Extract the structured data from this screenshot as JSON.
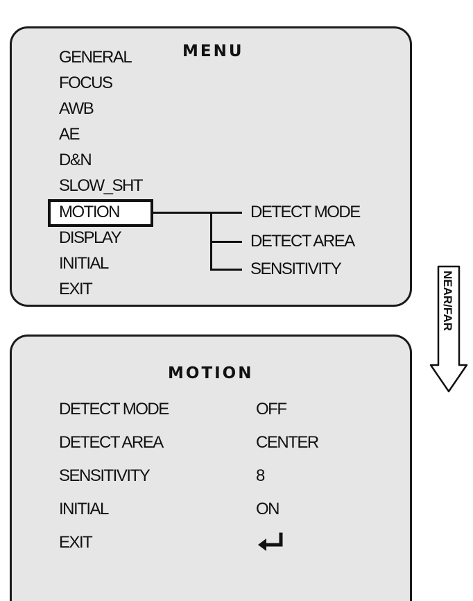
{
  "menu": {
    "title": "MENU",
    "items": [
      "GENERAL",
      "FOCUS",
      "AWB",
      "AE",
      "D&N",
      "SLOW_SHT",
      "MOTION",
      "DISPLAY",
      "INITIAL",
      "EXIT"
    ],
    "selected": "MOTION",
    "submenu": [
      "DETECT MODE",
      "DETECT AREA",
      "SENSITIVITY"
    ]
  },
  "motion": {
    "title": "MOTION",
    "rows": [
      {
        "label": "DETECT MODE",
        "value": "OFF"
      },
      {
        "label": "DETECT AREA",
        "value": "CENTER"
      },
      {
        "label": "SENSITIVITY",
        "value": "8"
      },
      {
        "label": "INITIAL",
        "value": "ON"
      },
      {
        "label": "EXIT",
        "value": ""
      }
    ],
    "exit_icon": "return-arrow-icon"
  },
  "side_arrow": {
    "label": "NEAR/FAR",
    "icon": "down-arrow-icon"
  }
}
